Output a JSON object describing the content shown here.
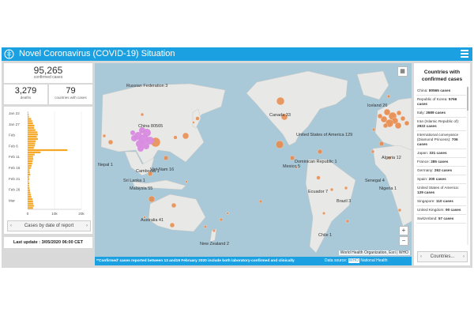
{
  "header": {
    "title": "Novel Coronavirus (COVID-19) Situation"
  },
  "summary": {
    "confirmed_value": "95,265",
    "confirmed_label": "confirmed cases",
    "deaths_value": "3,279",
    "deaths_label": "deaths",
    "countries_value": "79",
    "countries_label": "countries with cases"
  },
  "timeline": {
    "button_label": "Cases by date of report",
    "update_text": "Last update : 3/05/2020 06:00 CET"
  },
  "chart_data": {
    "type": "bar",
    "orientation": "horizontal",
    "y_tick_labels": [
      "Jan 22",
      "Jan 27",
      "Feb",
      "Feb 6",
      "Feb 11",
      "Feb 16",
      "Feb 21",
      "Feb 26",
      "Mar"
    ],
    "x_tick_labels": [
      "0",
      "10k",
      "20k"
    ],
    "xlim": [
      0,
      20000
    ],
    "values": [
      200,
      350,
      450,
      1300,
      1700,
      2000,
      2500,
      2400,
      2900,
      3600,
      3800,
      3400,
      3800,
      3000,
      2800,
      2700,
      2300,
      14800,
      4800,
      2600,
      2000,
      2100,
      1800,
      1700,
      1500,
      1200,
      700,
      800,
      1000,
      500,
      600,
      400,
      600,
      500,
      700,
      900,
      1000,
      1200,
      1400,
      1800,
      2000,
      2100,
      2300,
      2000
    ],
    "color": "#f5a623"
  },
  "map": {
    "labels": [
      "Russian Federation 3",
      "China 80565",
      "Nepal 1",
      "Sri Lanka 1",
      "Malaysia 55",
      "Cambodia 1",
      "Viet Nam 16",
      "Australia 41",
      "New Zealand 2",
      "Canada 33",
      "United States of America 129",
      "Mexico 5",
      "Dominican Republic 1",
      "Ecuador 7",
      "Brazil 3",
      "Chile 1",
      "Senegal 4",
      "Nigeria 1",
      "Algeria 12",
      "Iceland 26"
    ],
    "attribution": "World Health Organization, Esri | WHO",
    "footnote": "*'Confirmed' cases reported between 13 and19 February 2020 include both laboratory-confirmed and clinically",
    "source_prefix": "Data source:",
    "source_badge": "WHO",
    "source_suffix": "National Health",
    "zoom_in": "+",
    "zoom_out": "−",
    "land_color": "#e8e8e6",
    "water_color": "#a9c8d8",
    "bubble_color": "#e8894a",
    "china_color": "#d98be0"
  },
  "right_panel": {
    "title": "Countries with confirmed cases",
    "countries": [
      {
        "name": "China:",
        "value": "80565 cases"
      },
      {
        "name": "Republic of Korea:",
        "value": "5766 cases"
      },
      {
        "name": "Italy:",
        "value": "2689 cases"
      },
      {
        "name": "Iran (Islamic Republic of):",
        "value": "2922 cases"
      },
      {
        "name": "International conveyance (Diamond Princess):",
        "value": "706 cases"
      },
      {
        "name": "Japan:",
        "value": "331 cases"
      },
      {
        "name": "France:",
        "value": "285 cases"
      },
      {
        "name": "Germany:",
        "value": "262 cases"
      },
      {
        "name": "Spain:",
        "value": "200 cases"
      },
      {
        "name": "United States of America:",
        "value": "129 cases"
      },
      {
        "name": "Singapore:",
        "value": "110 cases"
      },
      {
        "name": "United Kingdom:",
        "value": "90 cases"
      },
      {
        "name": "Switzerland:",
        "value": "57 cases"
      }
    ],
    "button_label": "Countries..."
  }
}
